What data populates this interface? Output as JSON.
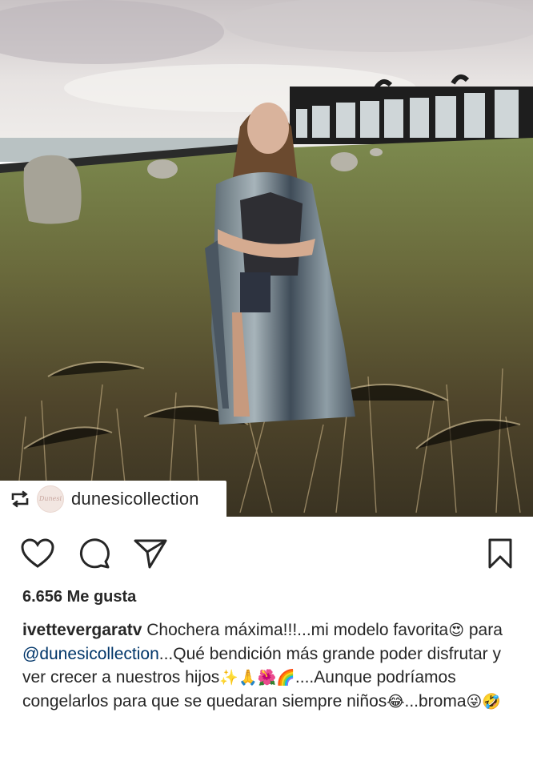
{
  "post": {
    "repost": {
      "username": "dunesicollection",
      "avatar_text": "Dunesi"
    },
    "likes_label": "6.656 Me gusta",
    "caption": {
      "username": "ivettevergaratv",
      "text_1": " Chochera máxima!!!...mi modelo favorita",
      "emoji_1": "😍",
      "text_2": " para ",
      "mention": "@dunesicollection",
      "text_3": "...Qué bendición más grande poder disfrutar y ver crecer a nuestros hijos",
      "emoji_2": "✨🙏🌺🌈",
      "text_4": "....Aunque podríamos congelarlos para que se quedaran siempre niños",
      "emoji_3": "😂",
      "text_5": "...broma",
      "emoji_4": "😜🤣"
    },
    "icons": {
      "like": "heart-icon",
      "comment": "comment-icon",
      "share": "send-icon",
      "save": "bookmark-icon",
      "repost": "repost-icon"
    }
  }
}
